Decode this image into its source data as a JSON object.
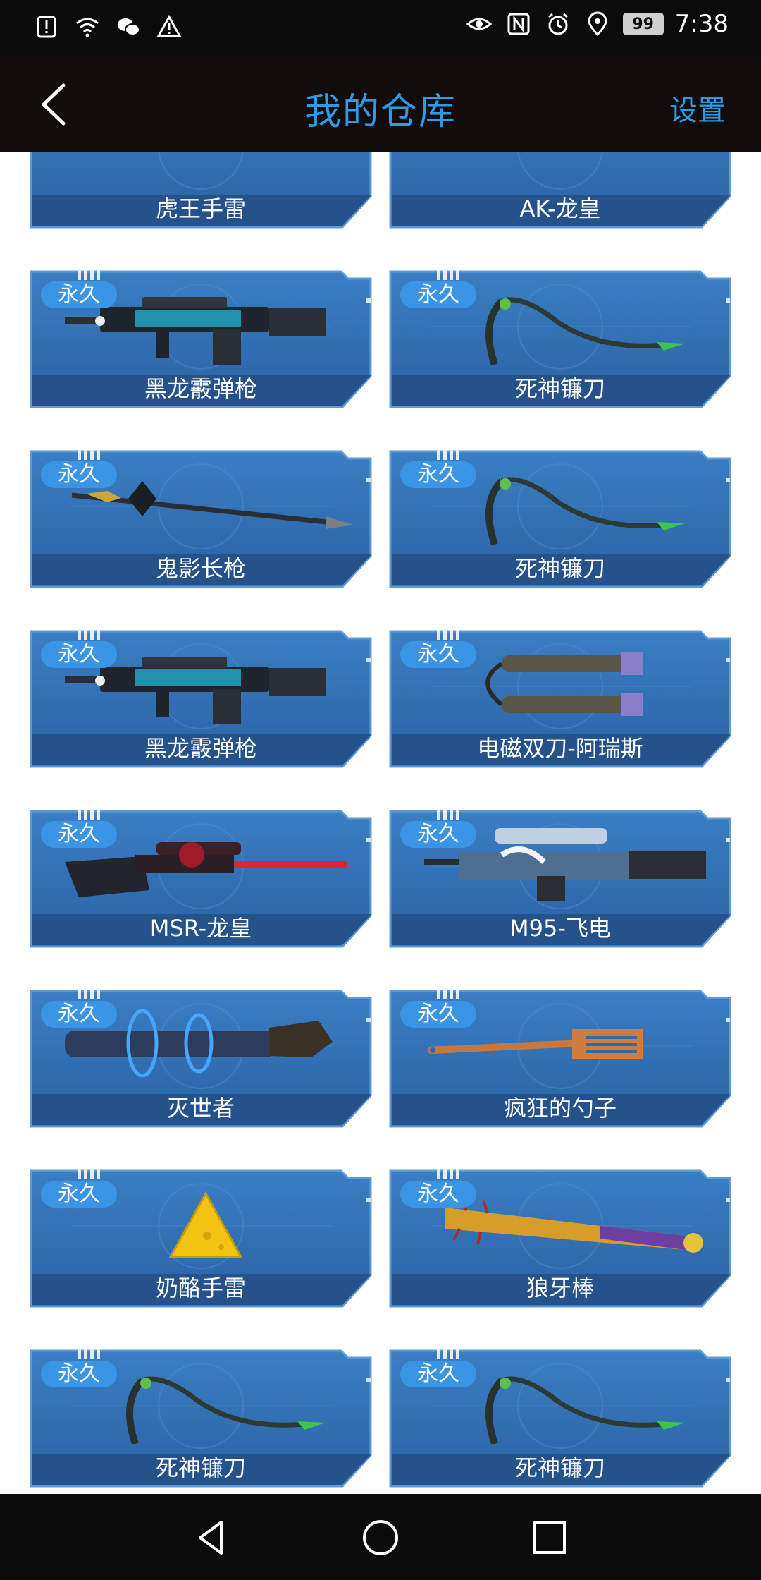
{
  "status_bar": {
    "time": "7:38",
    "battery": "99"
  },
  "header": {
    "title": "我的仓库",
    "settings_label": "设置"
  },
  "items": [
    {
      "name": "虎王手雷",
      "tag": "",
      "icon": "grenade-icon"
    },
    {
      "name": "AK-龙皇",
      "tag": "",
      "icon": "rifle-icon"
    },
    {
      "name": "黑龙霰弹枪",
      "tag": "永久",
      "icon": "shotgun-icon"
    },
    {
      "name": "死神镰刀",
      "tag": "永久",
      "icon": "scythe-icon"
    },
    {
      "name": "鬼影长枪",
      "tag": "永久",
      "icon": "spear-icon"
    },
    {
      "name": "死神镰刀",
      "tag": "永久",
      "icon": "scythe-icon"
    },
    {
      "name": "黑龙霰弹枪",
      "tag": "永久",
      "icon": "shotgun-icon"
    },
    {
      "name": "电磁双刀-阿瑞斯",
      "tag": "永久",
      "icon": "twin-blade-icon"
    },
    {
      "name": "MSR-龙皇",
      "tag": "永久",
      "icon": "sniper-rifle-icon"
    },
    {
      "name": "M95-飞电",
      "tag": "永久",
      "icon": "heavy-sniper-icon"
    },
    {
      "name": "灭世者",
      "tag": "永久",
      "icon": "gauntlet-icon"
    },
    {
      "name": "疯狂的勺子",
      "tag": "永久",
      "icon": "spatula-icon"
    },
    {
      "name": "奶酪手雷",
      "tag": "永久",
      "icon": "cheese-grenade-icon"
    },
    {
      "name": "狼牙棒",
      "tag": "永久",
      "icon": "spiked-bat-icon"
    },
    {
      "name": "死神镰刀",
      "tag": "永久",
      "icon": "scythe-icon"
    },
    {
      "name": "死神镰刀",
      "tag": "永久",
      "icon": "scythe-icon"
    }
  ],
  "colors": {
    "accent": "#2d9be8",
    "card": "#2f6aab",
    "card_label_band": "#27558d",
    "tag": "#3a95e6",
    "header_bg": "#120d0a"
  }
}
